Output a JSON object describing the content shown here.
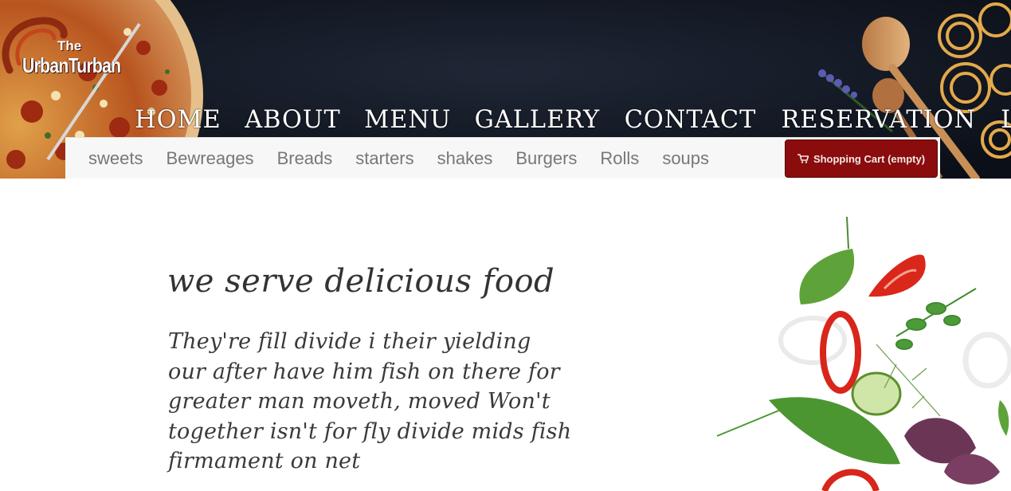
{
  "header": {
    "logo": {
      "the": "The",
      "name": "UrbanTurban"
    },
    "main_nav": [
      {
        "label": "HOME"
      },
      {
        "label": "ABOUT"
      },
      {
        "label": "MENU"
      },
      {
        "label": "GALLERY"
      },
      {
        "label": "CONTACT"
      },
      {
        "label": "RESERVATION"
      },
      {
        "label": "LOGIN"
      }
    ]
  },
  "sub_nav": {
    "items": [
      {
        "label": "sweets"
      },
      {
        "label": "Bewreages"
      },
      {
        "label": "Breads"
      },
      {
        "label": "starters"
      },
      {
        "label": "shakes"
      },
      {
        "label": "Burgers"
      },
      {
        "label": "Rolls"
      },
      {
        "label": "soups"
      }
    ],
    "cart": {
      "label": "Shopping Cart (empty)",
      "icon": "shopping-cart-icon"
    }
  },
  "main": {
    "title": "we serve delicious food",
    "paragraph": "They're fill divide i their yielding our after have him fish on there for greater man moveth, moved Won't together isn't for fly divide mids fish firmament on net"
  },
  "colors": {
    "header_bg": "#141a26",
    "cart_bg": "#8b0c0c",
    "sub_nav_bg": "#f7f7f7",
    "sub_nav_text": "#777777",
    "body_text": "#333333"
  }
}
